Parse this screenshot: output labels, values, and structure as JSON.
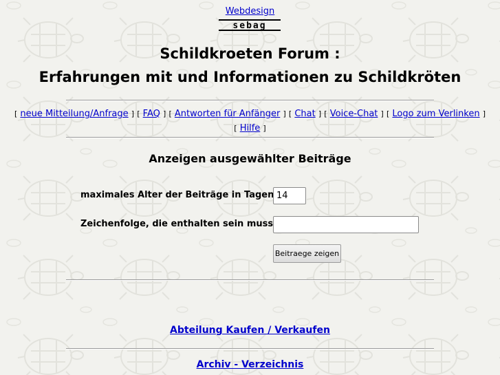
{
  "header": {
    "top_link": "Webdesign",
    "logo_text": "sebag",
    "title_line1": "Schildkroeten Forum :",
    "title_line2": "Erfahrungen mit und Informationen zu Schildkröten"
  },
  "nav": {
    "items": [
      {
        "label": "neue Mitteilung/Anfrage"
      },
      {
        "label": "FAQ"
      },
      {
        "label": "Antworten für Anfänger"
      },
      {
        "label": "Chat"
      },
      {
        "label": "Voice-Chat"
      },
      {
        "label": "Logo zum Verlinken"
      },
      {
        "label": "Hilfe"
      }
    ],
    "bracket_open": "[",
    "bracket_close": "]"
  },
  "filter": {
    "section_title": "Anzeigen ausgewählter Beiträge",
    "age_label": "maximales Alter der Beiträge in Tagen:",
    "age_value": "14",
    "text_label": "Zeichenfolge, die enthalten sein muss:",
    "text_value": "",
    "submit_label": "Beitraege zeigen"
  },
  "footer_links": {
    "kaufen": "Abteilung Kaufen / Verkaufen",
    "archiv": "Archiv - Verzeichnis"
  },
  "colors": {
    "link": "#0000cc",
    "background": "#f2f2ee"
  }
}
